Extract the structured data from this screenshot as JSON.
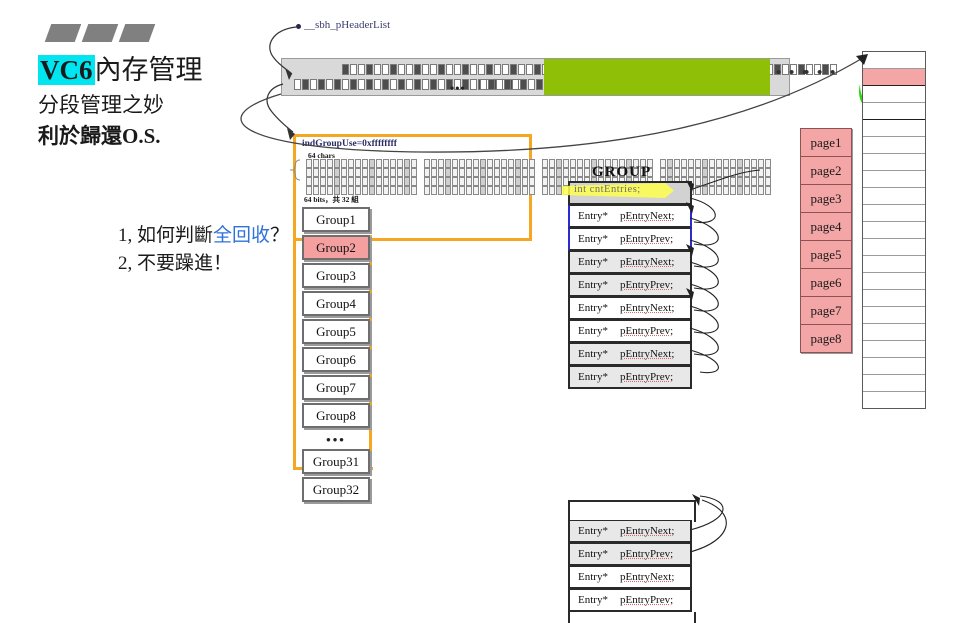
{
  "title": {
    "main_prefix": "VC6",
    "main_rest": "內存管理",
    "sub1": "分段管理之妙",
    "sub2": "利於歸還O.S."
  },
  "questions": [
    {
      "num": "1, ",
      "pre": "如何判斷",
      "hl": "全回收",
      "post": "？"
    },
    {
      "num": "2, ",
      "pre": "不要躁進！",
      "hl": "",
      "post": ""
    }
  ],
  "header_list": {
    "pointer_label": "__sbh_pHeaderList",
    "ellipsis_mid": "•••",
    "ellipsis_a": "• • •",
    "ellipsis_b": "• • •"
  },
  "bitmap_panel": {
    "ind_label": "indGroupUse=0xffffffff",
    "chars_label": "64 chars",
    "bits_label": "64 bits，共 32 組"
  },
  "groups": {
    "items": [
      "Group1",
      "Group2",
      "Group3",
      "Group4",
      "Group5",
      "Group6",
      "Group7",
      "Group8"
    ],
    "ellipsis": "•••",
    "tail": [
      "Group31",
      "Group32"
    ],
    "selected": "Group2"
  },
  "group_table": {
    "title": "GROUP",
    "highlight_row": "int cntEntries;",
    "rows": [
      {
        "type": "Entry*",
        "field": "pEntryNext;"
      },
      {
        "type": "Entry*",
        "field": "pEntryPrev;"
      },
      {
        "type": "Entry*",
        "field": "pEntryNext;"
      },
      {
        "type": "Entry*",
        "field": "pEntryPrev;"
      },
      {
        "type": "Entry*",
        "field": "pEntryNext;"
      },
      {
        "type": "Entry*",
        "field": "pEntryPrev;"
      },
      {
        "type": "Entry*",
        "field": "pEntryNext;"
      },
      {
        "type": "Entry*",
        "field": "pEntryPrev;"
      }
    ],
    "rows_lower": [
      {
        "type": "Entry*",
        "field": "pEntryNext;"
      },
      {
        "type": "Entry*",
        "field": "pEntryPrev;"
      },
      {
        "type": "Entry*",
        "field": "pEntryNext;"
      },
      {
        "type": "Entry*",
        "field": "pEntryPrev;"
      }
    ]
  },
  "pages": {
    "items": [
      "page1",
      "page2",
      "page3",
      "page4",
      "page5",
      "page6",
      "page7",
      "page8"
    ]
  },
  "colors": {
    "accent_orange": "#f5a623",
    "highlight_cyan": "#00e5ef",
    "green_block": "#8fbf06",
    "page_red": "#f4a6a6",
    "link_blue": "#2f72d8",
    "yellow_marker": "#ffff4d"
  }
}
